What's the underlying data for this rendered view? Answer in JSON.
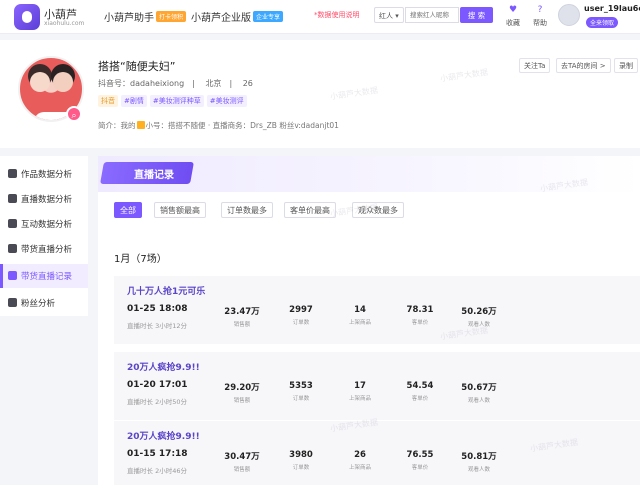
{
  "header": {
    "brand": "小葫芦",
    "brand_sub": "xiaohulu.com",
    "nav": [
      {
        "label": "小葫芦助手",
        "tag": "打卡领积"
      },
      {
        "label": "小葫芦企业版",
        "tag": "企业专享"
      }
    ],
    "notice": "*数据使用说明",
    "search_type": "红人",
    "search_placeholder": "搜索红人昵称",
    "search_button": "搜 索",
    "collect_label": "收藏",
    "help_label": "帮助",
    "username": "user_19lau6ou",
    "user_badge": "全来领取"
  },
  "profile": {
    "name": "搭搭“随便夫妇”",
    "douyin_id": "抖音号：dadaheixiong",
    "city": "北京",
    "age": "26",
    "tags": [
      "抖音",
      "#剧情",
      "#美妆测评种草",
      "#美妆测评"
    ],
    "intro_prefix": "简介：我的",
    "intro_suffix": "小号：搭搭不随便 · 直播商务：Drs_ZB 粉丝v:dadanjt01",
    "buttons": [
      "关注Ta",
      "去TA的房间 >",
      "录制"
    ]
  },
  "watermark": "小葫芦大数据",
  "sidebar": {
    "items": [
      {
        "label": "作品数据分析",
        "active": false
      },
      {
        "label": "直播数据分析",
        "active": false
      },
      {
        "label": "互动数据分析",
        "active": false
      },
      {
        "label": "带货直播分析",
        "active": false
      },
      {
        "label": "带货直播记录",
        "active": true
      },
      {
        "label": "粉丝分析",
        "active": false
      }
    ]
  },
  "main": {
    "banner_title": "直播记录",
    "filters": [
      {
        "label": "全部",
        "active": true
      },
      {
        "label": "销售额最高",
        "active": false
      },
      {
        "label": "订单数最多",
        "active": false
      },
      {
        "label": "客单价最高",
        "active": false
      },
      {
        "label": "观众数最多",
        "active": false
      }
    ],
    "month": "1月（7场）",
    "stat_labels": [
      "销售额",
      "订单数",
      "上架商品",
      "客单价",
      "观看人数"
    ],
    "records": [
      {
        "title": "几十万人抢1元可乐",
        "date": "01-25 18:08",
        "duration": "直播时长 3小时12分",
        "sales": "23.47万",
        "orders": "2997",
        "items": "14",
        "price": "78.31",
        "viewers": "50.26万"
      },
      {
        "title": "20万人疯抢9.9!!",
        "date": "01-20 17:01",
        "duration": "直播时长 2小时50分",
        "sales": "29.20万",
        "orders": "5353",
        "items": "17",
        "price": "54.54",
        "viewers": "50.67万"
      },
      {
        "title": "20万人疯抢9.9!!",
        "date": "01-15 17:18",
        "duration": "直播时长 2小时46分",
        "sales": "30.47万",
        "orders": "3980",
        "items": "26",
        "price": "76.55",
        "viewers": "50.81万"
      }
    ]
  }
}
